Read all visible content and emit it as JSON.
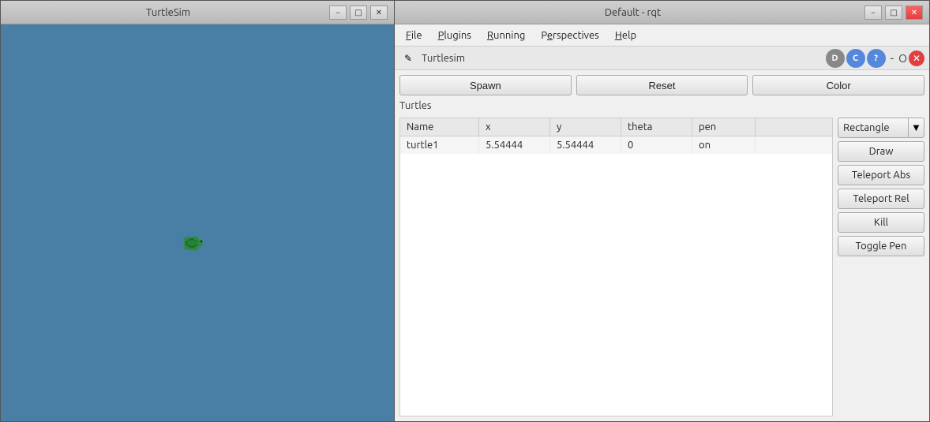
{
  "turtlesim": {
    "title": "TurtleSim",
    "minimize_label": "−",
    "maximize_label": "□",
    "close_label": "✕",
    "canvas_bg": "#4a7fa5"
  },
  "rqt": {
    "title": "Default - rqt",
    "minimize_label": "−",
    "maximize_label": "□",
    "close_label": "✕"
  },
  "menubar": {
    "items": [
      {
        "label": "File",
        "underline": "F"
      },
      {
        "label": "Plugins",
        "underline": "P"
      },
      {
        "label": "Running",
        "underline": "R"
      },
      {
        "label": "Perspectives",
        "underline": "e"
      },
      {
        "label": "Help",
        "underline": "H"
      }
    ]
  },
  "plugin_bar": {
    "icon": "✎",
    "label": "Turtlesim",
    "toolbar_icons": {
      "d": "D",
      "c": "C",
      "help": "?",
      "dash": "-",
      "o": "O",
      "close": "✕"
    }
  },
  "turtlesim_panel": {
    "turtles_label": "Turtles",
    "buttons": {
      "spawn": "Spawn",
      "reset": "Reset",
      "color": "Color"
    }
  },
  "table": {
    "headers": [
      "Name",
      "x",
      "y",
      "theta",
      "pen"
    ],
    "rows": [
      {
        "name": "turtle1",
        "x": "5.54444",
        "y": "5.54444",
        "theta": "0",
        "pen": "on"
      }
    ]
  },
  "right_panel": {
    "rectangle_label": "Rectangle",
    "dropdown_arrow": "▼",
    "buttons": [
      {
        "id": "draw",
        "label": "Draw"
      },
      {
        "id": "teleport_abs",
        "label": "Teleport Abs"
      },
      {
        "id": "teleport_rel",
        "label": "Teleport Rel"
      },
      {
        "id": "kill",
        "label": "Kill"
      },
      {
        "id": "toggle_pen",
        "label": "Toggle Pen"
      }
    ]
  }
}
